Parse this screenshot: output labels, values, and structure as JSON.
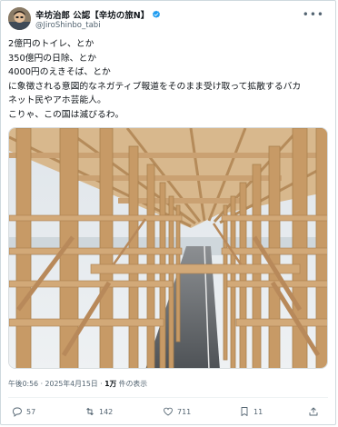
{
  "post": {
    "display_name": "辛坊治郎 公認【辛坊の旅N】",
    "handle": "@JiroShinbo_tabi",
    "more_icon": "more-dots-icon",
    "text_lines": [
      "2億円のトイレ、とか",
      "350億円の日除、とか",
      "4000円のえきそば、とか",
      "に象徴される意図的なネガティブ報道をそのまま受け取って拡散するバカ",
      "ネット民やアホ芸能人。",
      "こりゃ、この国は滅びるわ。"
    ],
    "timestamp": "午後0:56 · 2025年4月15日 · ",
    "views_count": "1万",
    "views_label": " 件の表示"
  },
  "actions": {
    "reply_count": "57",
    "repost_count": "142",
    "like_count": "711",
    "bookmark_count": "11"
  },
  "colors": {
    "text": "#0f1419",
    "secondary": "#536471",
    "border": "#cfd9de",
    "verified": "#1d9bf0",
    "wood": "#c9a273",
    "sky": "#e9edf0"
  }
}
